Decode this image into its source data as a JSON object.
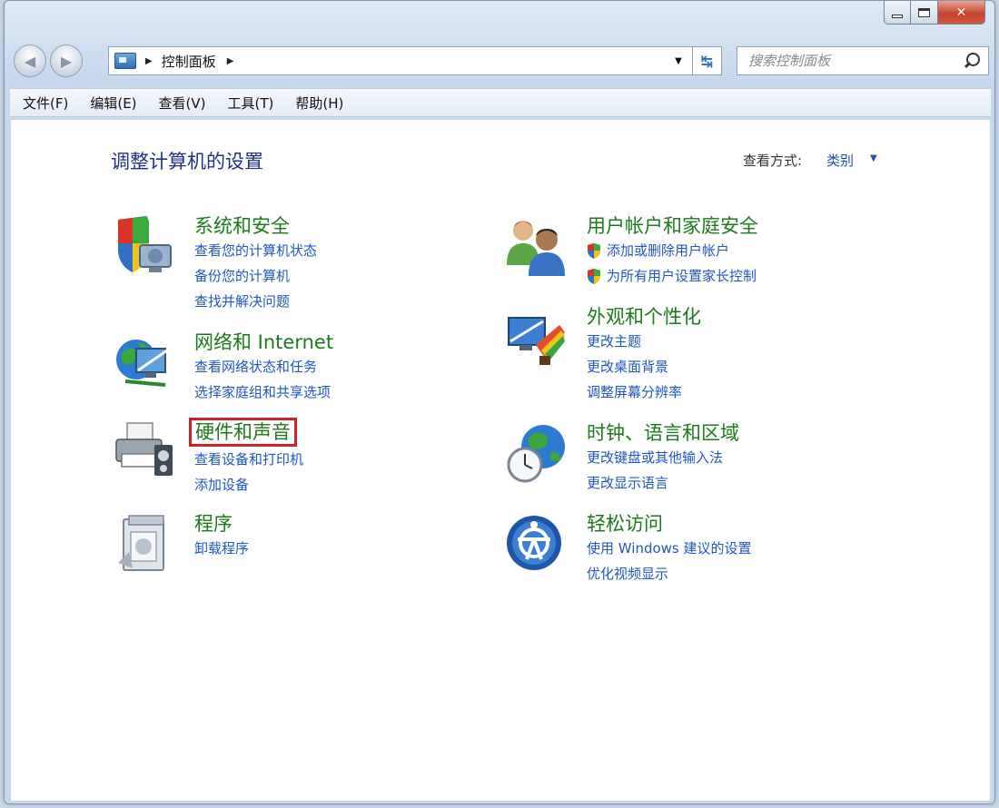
{
  "window": {
    "close_label": "✕"
  },
  "nav": {
    "back_arrow": "◀",
    "forward_arrow": "▶",
    "breadcrumb": "控制面板",
    "search_placeholder": "搜索控制面板"
  },
  "menu": {
    "items": [
      "文件(F)",
      "编辑(E)",
      "查看(V)",
      "工具(T)",
      "帮助(H)"
    ]
  },
  "content": {
    "title": "调整计算机的设置",
    "view_label": "查看方式:",
    "view_value": "类别"
  },
  "categories": [
    {
      "title": "系统和安全",
      "icon": "shield-computer-icon",
      "links": [
        "查看您的计算机状态",
        "备份您的计算机",
        "查找并解决问题"
      ]
    },
    {
      "title": "网络和 Internet",
      "icon": "network-globe-icon",
      "links": [
        "查看网络状态和任务",
        "选择家庭组和共享选项"
      ]
    },
    {
      "title": "硬件和声音",
      "icon": "printer-icon",
      "highlighted": true,
      "links": [
        "查看设备和打印机",
        "添加设备"
      ]
    },
    {
      "title": "程序",
      "icon": "programs-icon",
      "links": [
        "卸载程序"
      ]
    },
    {
      "title": "用户帐户和家庭安全",
      "icon": "users-icon",
      "links": [
        "添加或删除用户帐户",
        "为所有用户设置家长控制"
      ]
    },
    {
      "title": "外观和个性化",
      "icon": "appearance-icon",
      "links": [
        "更改主题",
        "更改桌面背景",
        "调整屏幕分辨率"
      ]
    },
    {
      "title": "时钟、语言和区域",
      "icon": "clock-globe-icon",
      "links": [
        "更改键盘或其他输入法",
        "更改显示语言"
      ]
    },
    {
      "title": "轻松访问",
      "icon": "ease-of-access-icon",
      "links": [
        "使用 Windows 建议的设置",
        "优化视频显示"
      ]
    }
  ],
  "colors": {
    "category_title": "#1c7a1c",
    "link": "#1f56c2",
    "highlight_border": "#c8222a",
    "page_title": "#1e3287"
  }
}
